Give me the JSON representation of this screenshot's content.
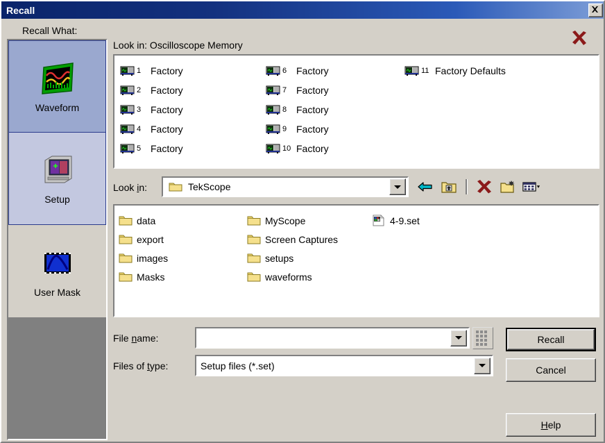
{
  "window": {
    "title": "Recall",
    "close_icon": "close-icon"
  },
  "sidebar": {
    "label": "Recall What:",
    "items": [
      {
        "label": "Waveform",
        "icon": "waveform-icon",
        "state": "selected"
      },
      {
        "label": "Setup",
        "icon": "setup-icon",
        "state": "highlighted"
      },
      {
        "label": "User Mask",
        "icon": "user-mask-icon",
        "state": "normal"
      }
    ]
  },
  "memory": {
    "lookin_label": "Look in: Oscilloscope Memory",
    "delete_icon": "delete-x-icon",
    "column1": [
      {
        "num": "1",
        "name": "Factory",
        "icon": "scope-icon"
      },
      {
        "num": "2",
        "name": "Factory",
        "icon": "scope-icon"
      },
      {
        "num": "3",
        "name": "Factory",
        "icon": "scope-icon"
      },
      {
        "num": "4",
        "name": "Factory",
        "icon": "scope-icon"
      },
      {
        "num": "5",
        "name": "Factory",
        "icon": "scope-icon"
      }
    ],
    "column2": [
      {
        "num": "6",
        "name": "Factory",
        "icon": "scope-icon"
      },
      {
        "num": "7",
        "name": "Factory",
        "icon": "scope-icon"
      },
      {
        "num": "8",
        "name": "Factory",
        "icon": "scope-icon"
      },
      {
        "num": "9",
        "name": "Factory",
        "icon": "scope-icon"
      },
      {
        "num": "10",
        "name": "Factory",
        "icon": "scope-icon"
      }
    ],
    "column3": [
      {
        "num": "11",
        "name": "Factory Defaults",
        "icon": "scope-icon"
      }
    ]
  },
  "browser": {
    "lookin_label_pre": "Look ",
    "lookin_label_key": "i",
    "lookin_label_post": "n:",
    "lookin_value": "TekScope",
    "lookin_folder_icon": "folder-icon",
    "toolbar": [
      {
        "name": "back-button",
        "icon": "back-arrow-icon"
      },
      {
        "name": "up-one-level-button",
        "icon": "up-folder-icon"
      },
      {
        "name": "delete-button",
        "icon": "delete-x-icon"
      },
      {
        "name": "new-folder-button",
        "icon": "new-folder-icon"
      },
      {
        "name": "views-button",
        "icon": "views-icon"
      }
    ],
    "files_column1": [
      {
        "name": "data",
        "type": "folder",
        "icon": "folder-icon"
      },
      {
        "name": "export",
        "type": "folder",
        "icon": "folder-icon"
      },
      {
        "name": "images",
        "type": "folder",
        "icon": "folder-icon"
      },
      {
        "name": "Masks",
        "type": "folder",
        "icon": "folder-icon"
      }
    ],
    "files_column2": [
      {
        "name": "MyScope",
        "type": "folder",
        "icon": "folder-icon"
      },
      {
        "name": "Screen Captures",
        "type": "folder",
        "icon": "folder-icon"
      },
      {
        "name": "setups",
        "type": "folder",
        "icon": "folder-icon"
      },
      {
        "name": "waveforms",
        "type": "folder",
        "icon": "folder-icon"
      }
    ],
    "files_column3": [
      {
        "name": "4-9.set",
        "type": "file",
        "icon": "set-file-icon"
      }
    ]
  },
  "form": {
    "filename_label_pre": "File ",
    "filename_label_key": "n",
    "filename_label_post": "ame:",
    "filename_value": "",
    "filename_placeholder": "",
    "keypad_icon": "keypad-icon",
    "filetype_label_pre": "Files of ",
    "filetype_label_key": "t",
    "filetype_label_post": "ype:",
    "filetype_value": "Setup files (*.set)",
    "filetype_options": [
      "Setup files (*.set)"
    ]
  },
  "buttons": {
    "recall": "Recall",
    "cancel": "Cancel",
    "help_pre": "",
    "help_key": "H",
    "help_post": "elp"
  },
  "colors": {
    "titlebar_start": "#0a246a",
    "titlebar_end": "#7f9fd8",
    "dialog_face": "#d4d0c8",
    "selected_item": "#9aa8cf",
    "highlight_item": "#c3c8e0",
    "filler": "#808080",
    "delete_red": "#8b1a1a",
    "folder_yellow": "#f5e08c"
  }
}
